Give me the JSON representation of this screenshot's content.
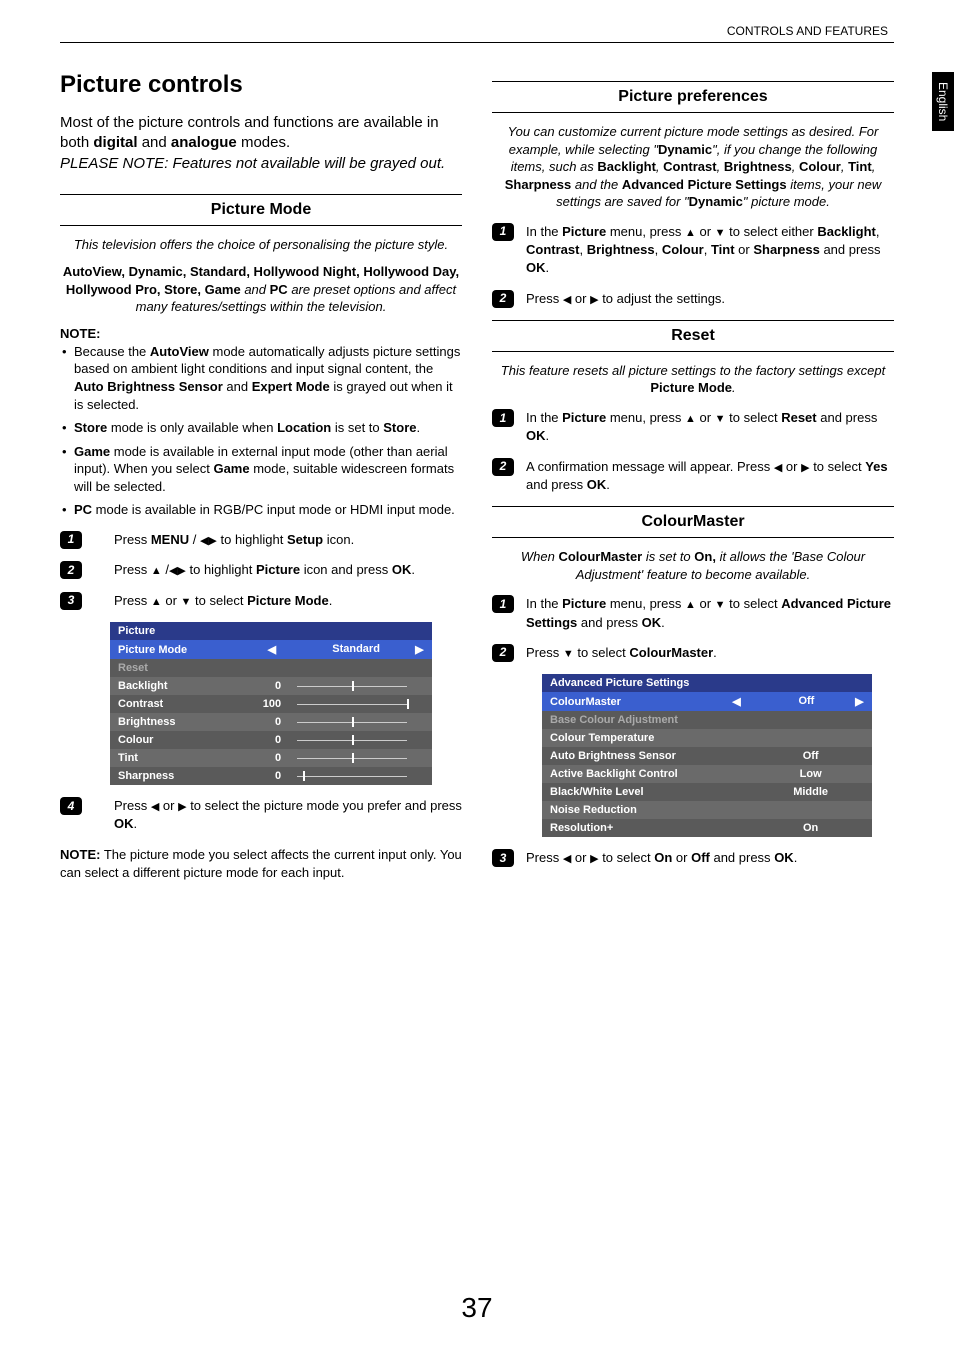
{
  "header": {
    "section": "CONTROLS AND FEATURES"
  },
  "sideTab": "English",
  "left": {
    "h1": "Picture controls",
    "intro1": "Most of the picture controls and functions are available in both ",
    "introDigital": "digital",
    "introAnd": " and ",
    "introAnalogue": "analogue",
    "intro2": " modes.",
    "introNote": "PLEASE NOTE: Features not available will be grayed out.",
    "pm_title": "Picture Mode",
    "pm_desc": "This television offers the choice of personalising the picture style.",
    "pm_modes1": "AutoView, Dynamic, Standard, Hollywood Night, Hollywood Day, Hollywood Pro, Store, Game",
    "pm_modes_and": " and ",
    "pm_modes_pc": "PC",
    "pm_modes_tail": " are preset options and affect many features/settings within the television.",
    "note_label": "NOTE:",
    "note1a": "Because the ",
    "note1b": "AutoView",
    "note1c": " mode automatically adjusts picture settings based on ambient light conditions and input signal content, the ",
    "note1d": "Auto Brightness Sensor",
    "note1e": " and ",
    "note1f": "Expert Mode",
    "note1g": " is grayed out when it is selected.",
    "note2a": "Store",
    "note2b": " mode is only available when ",
    "note2c": "Location",
    "note2d": " is set to ",
    "note2e": "Store",
    "note2f": ".",
    "note3a": "Game",
    "note3b": " mode is available in external input mode (other than aerial input). When you select ",
    "note3c": "Game",
    "note3d": " mode, suitable widescreen formats will be selected.",
    "note4a": "PC",
    "note4b": " mode is available in RGB/PC input mode or HDMI input mode.",
    "step1a": "Press ",
    "step1b": "MENU",
    "step1c": " / ",
    "step1d": " to highlight ",
    "step1e": "Setup",
    "step1f": " icon.",
    "step2a": "Press ",
    "step2b": " /",
    "step2c": " to highlight ",
    "step2d": "Picture",
    "step2e": " icon and press ",
    "step2f": "OK",
    "step2g": ".",
    "step3a": "Press ",
    "step3b": " or ",
    "step3c": " to select ",
    "step3d": "Picture Mode",
    "step3e": ".",
    "menu": {
      "title": "Picture",
      "rows": [
        {
          "label": "Picture Mode",
          "value": "Standard",
          "selected": true
        },
        {
          "label": "Reset",
          "value": "",
          "disabled": true
        },
        {
          "label": "Backlight",
          "value": "0",
          "slider": 50
        },
        {
          "label": "Contrast",
          "value": "100",
          "slider": 100
        },
        {
          "label": "Brightness",
          "value": "0",
          "slider": 50
        },
        {
          "label": "Colour",
          "value": "0",
          "slider": 50
        },
        {
          "label": "Tint",
          "value": "0",
          "slider": 50
        },
        {
          "label": "Sharpness",
          "value": "0",
          "slider": 5
        }
      ]
    },
    "step4a": "Press ",
    "step4b": " or ",
    "step4c": " to select the picture mode you prefer and press ",
    "step4d": "OK",
    "step4e": ".",
    "bottomNoteLabel": "NOTE:",
    "bottomNote": " The picture mode you select affects the current input only. You can select a different picture mode for each input."
  },
  "right": {
    "pp_title": "Picture preferences",
    "pp_desc1": "You can customize current picture mode settings as desired. For example, while selecting \"",
    "pp_desc_dyn": "Dynamic",
    "pp_desc2": "\", if you change the following items, such as ",
    "pp_b1": "Backlight",
    "pp_c1": ", ",
    "pp_b2": "Contrast",
    "pp_c2": ", ",
    "pp_b3": "Brightness",
    "pp_c3": ", ",
    "pp_b4": "Colour",
    "pp_c4": ", ",
    "pp_b5": "Tint",
    "pp_c5": ", ",
    "pp_b6": "Sharpness",
    "pp_desc3": " and the ",
    "pp_b7": "Advanced Picture Settings",
    "pp_desc4": " items, your new settings are saved for \"",
    "pp_desc_dyn2": "Dynamic",
    "pp_desc5": "\" picture mode.",
    "pp_s1a": "In the ",
    "pp_s1b": "Picture",
    "pp_s1c": " menu, press ",
    "pp_s1d": " or ",
    "pp_s1e": " to select either ",
    "pp_s1f": "Backlight",
    "pp_s1g": ", ",
    "pp_s1h": "Contrast",
    "pp_s1i": ", ",
    "pp_s1j": "Brightness",
    "pp_s1k": ", ",
    "pp_s1l": "Colour",
    "pp_s1m": ", ",
    "pp_s1n": "Tint",
    "pp_s1o": " or ",
    "pp_s1p": "Sharpness",
    "pp_s1q": " and press ",
    "pp_s1r": "OK",
    "pp_s1s": ".",
    "pp_s2a": "Press ",
    "pp_s2b": " or ",
    "pp_s2c": " to adjust the settings.",
    "reset_title": "Reset",
    "reset_desc1": "This feature resets all picture settings to the factory settings except ",
    "reset_desc2": "Picture Mode",
    "reset_desc3": ".",
    "r_s1a": "In the ",
    "r_s1b": "Picture",
    "r_s1c": " menu, press ",
    "r_s1d": " or ",
    "r_s1e": " to select ",
    "r_s1f": "Reset",
    "r_s1g": " and press ",
    "r_s1h": "OK",
    "r_s1i": ".",
    "r_s2a": "A confirmation message will appear. Press ",
    "r_s2b": " or ",
    "r_s2c": " to select ",
    "r_s2d": "Yes",
    "r_s2e": " and press ",
    "r_s2f": "OK",
    "r_s2g": ".",
    "cm_title": "ColourMaster",
    "cm_desc1": "When ",
    "cm_desc2": "ColourMaster",
    "cm_desc3": " is set to ",
    "cm_desc4": "On,",
    "cm_desc5": " it allows the 'Base Colour Adjustment' feature to become available.",
    "cm_s1a": "In the ",
    "cm_s1b": "Picture",
    "cm_s1c": " menu, press ",
    "cm_s1d": " or ",
    "cm_s1e": " to select ",
    "cm_s1f": "Advanced Picture Settings",
    "cm_s1g": " and press ",
    "cm_s1h": "OK",
    "cm_s1i": ".",
    "cm_s2a": "Press ",
    "cm_s2b": " to select ",
    "cm_s2c": "ColourMaster",
    "cm_s2d": ".",
    "adv": {
      "title": "Advanced Picture Settings",
      "rows": [
        {
          "label": "ColourMaster",
          "value": "Off",
          "selected": true
        },
        {
          "label": "Base Colour Adjustment",
          "value": "",
          "disabled": true
        },
        {
          "label": "Colour Temperature",
          "value": ""
        },
        {
          "label": "Auto Brightness Sensor",
          "value": "Off"
        },
        {
          "label": "Active Backlight Control",
          "value": "Low"
        },
        {
          "label": "Black/White Level",
          "value": "Middle"
        },
        {
          "label": "Noise Reduction",
          "value": ""
        },
        {
          "label": "Resolution+",
          "value": "On"
        }
      ]
    },
    "cm_s3a": "Press ",
    "cm_s3b": " or ",
    "cm_s3c": " to select ",
    "cm_s3d": "On",
    "cm_s3e": " or ",
    "cm_s3f": "Off",
    "cm_s3g": " and press ",
    "cm_s3h": "OK",
    "cm_s3i": "."
  },
  "pageNum": "37"
}
